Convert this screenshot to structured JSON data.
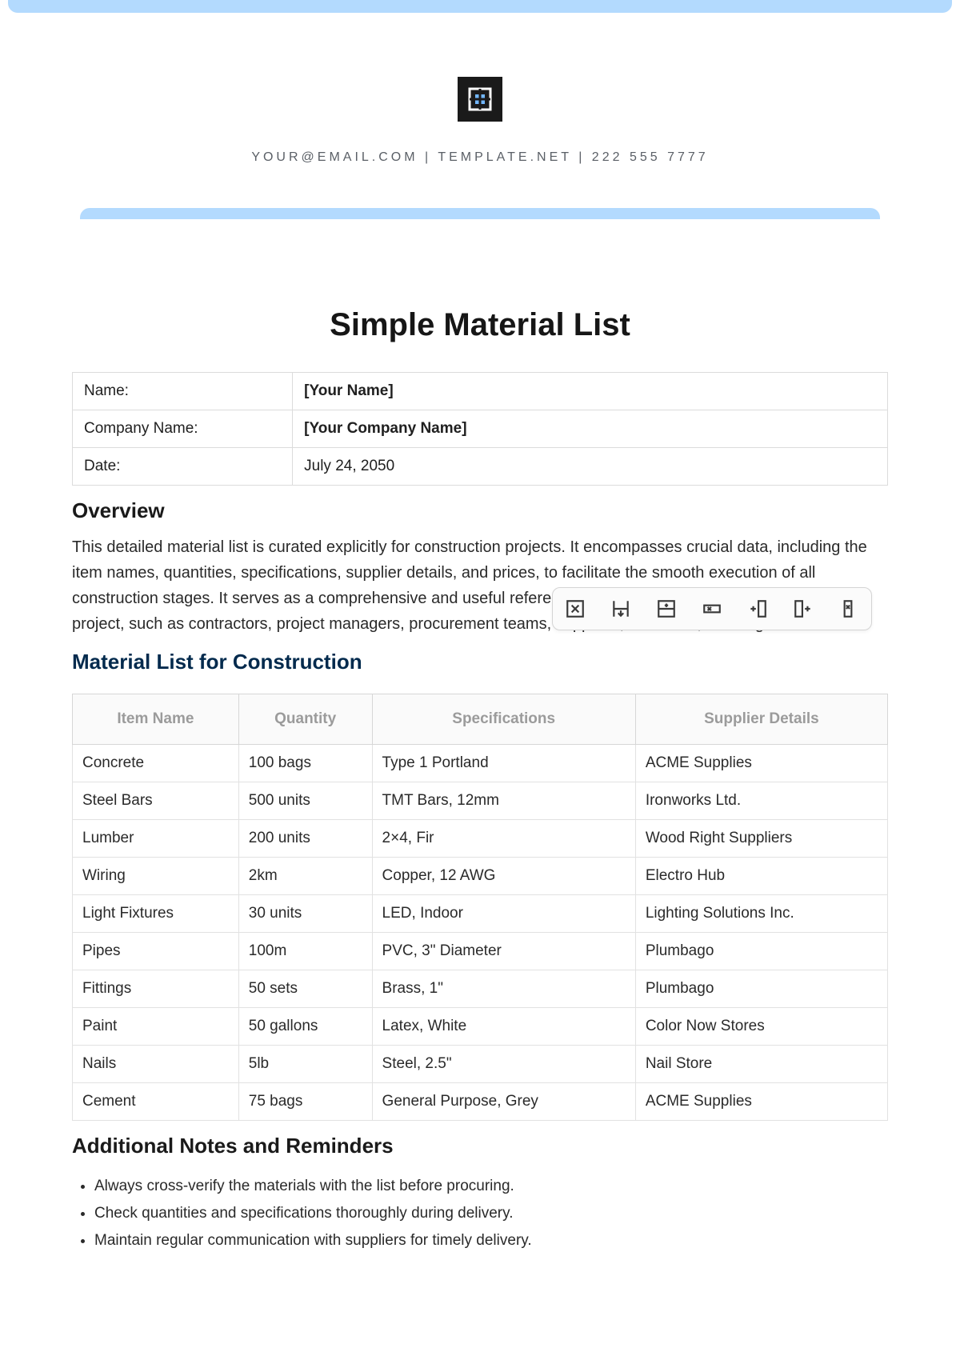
{
  "header": {
    "contact_line": "YOUR@EMAIL.COM | TEMPLATE.NET | 222 555 7777"
  },
  "title": "Simple Material List",
  "meta": {
    "name_label": "Name:",
    "name_value": "[Your Name]",
    "company_label": "Company Name:",
    "company_value": "[Your Company Name]",
    "date_label": "Date:",
    "date_value": "July 24, 2050"
  },
  "overview": {
    "heading": "Overview",
    "text": "This detailed material list is curated explicitly for construction projects. It encompasses crucial data, including the item names, quantities, specifications, supplier details, and prices, to facilitate the smooth execution of all construction stages. It serves as a comprehensive and useful reference for various stakeholders involved in the project, such as contractors, project managers, procurement teams, suppliers, architects, and engineers."
  },
  "materials": {
    "heading": "Material List for Construction",
    "columns": {
      "item": "Item Name",
      "qty": "Quantity",
      "spec": "Specifications",
      "supplier": "Supplier Details"
    },
    "rows": [
      {
        "item": "Concrete",
        "qty": "100 bags",
        "spec": "Type 1 Portland",
        "supplier": "ACME Supplies"
      },
      {
        "item": "Steel Bars",
        "qty": "500 units",
        "spec": "TMT Bars, 12mm",
        "supplier": "Ironworks Ltd."
      },
      {
        "item": "Lumber",
        "qty": "200 units",
        "spec": "2×4, Fir",
        "supplier": "Wood Right Suppliers"
      },
      {
        "item": "Wiring",
        "qty": "2km",
        "spec": "Copper, 12 AWG",
        "supplier": "Electro Hub"
      },
      {
        "item": "Light Fixtures",
        "qty": "30 units",
        "spec": "LED, Indoor",
        "supplier": "Lighting Solutions Inc."
      },
      {
        "item": "Pipes",
        "qty": "100m",
        "spec": "PVC, 3\" Diameter",
        "supplier": "Plumbago"
      },
      {
        "item": "Fittings",
        "qty": "50 sets",
        "spec": "Brass, 1\"",
        "supplier": "Plumbago"
      },
      {
        "item": "Paint",
        "qty": "50 gallons",
        "spec": "Latex, White",
        "supplier": "Color Now Stores"
      },
      {
        "item": "Nails",
        "qty": "5lb",
        "spec": "Steel, 2.5\"",
        "supplier": "Nail Store"
      },
      {
        "item": "Cement",
        "qty": "75 bags",
        "spec": "General Purpose, Grey",
        "supplier": "ACME Supplies"
      }
    ]
  },
  "notes": {
    "heading": "Additional Notes and Reminders",
    "items": [
      "Always cross-verify the materials with the list before procuring.",
      "Check quantities and specifications thoroughly during delivery.",
      "Maintain regular communication with suppliers for timely delivery."
    ]
  },
  "toolbar_icons": [
    "delete-cell-icon",
    "split-cell-down-icon",
    "insert-row-icon",
    "delete-row-icon",
    "insert-column-right-icon",
    "insert-column-left-icon",
    "delete-column-icon"
  ]
}
